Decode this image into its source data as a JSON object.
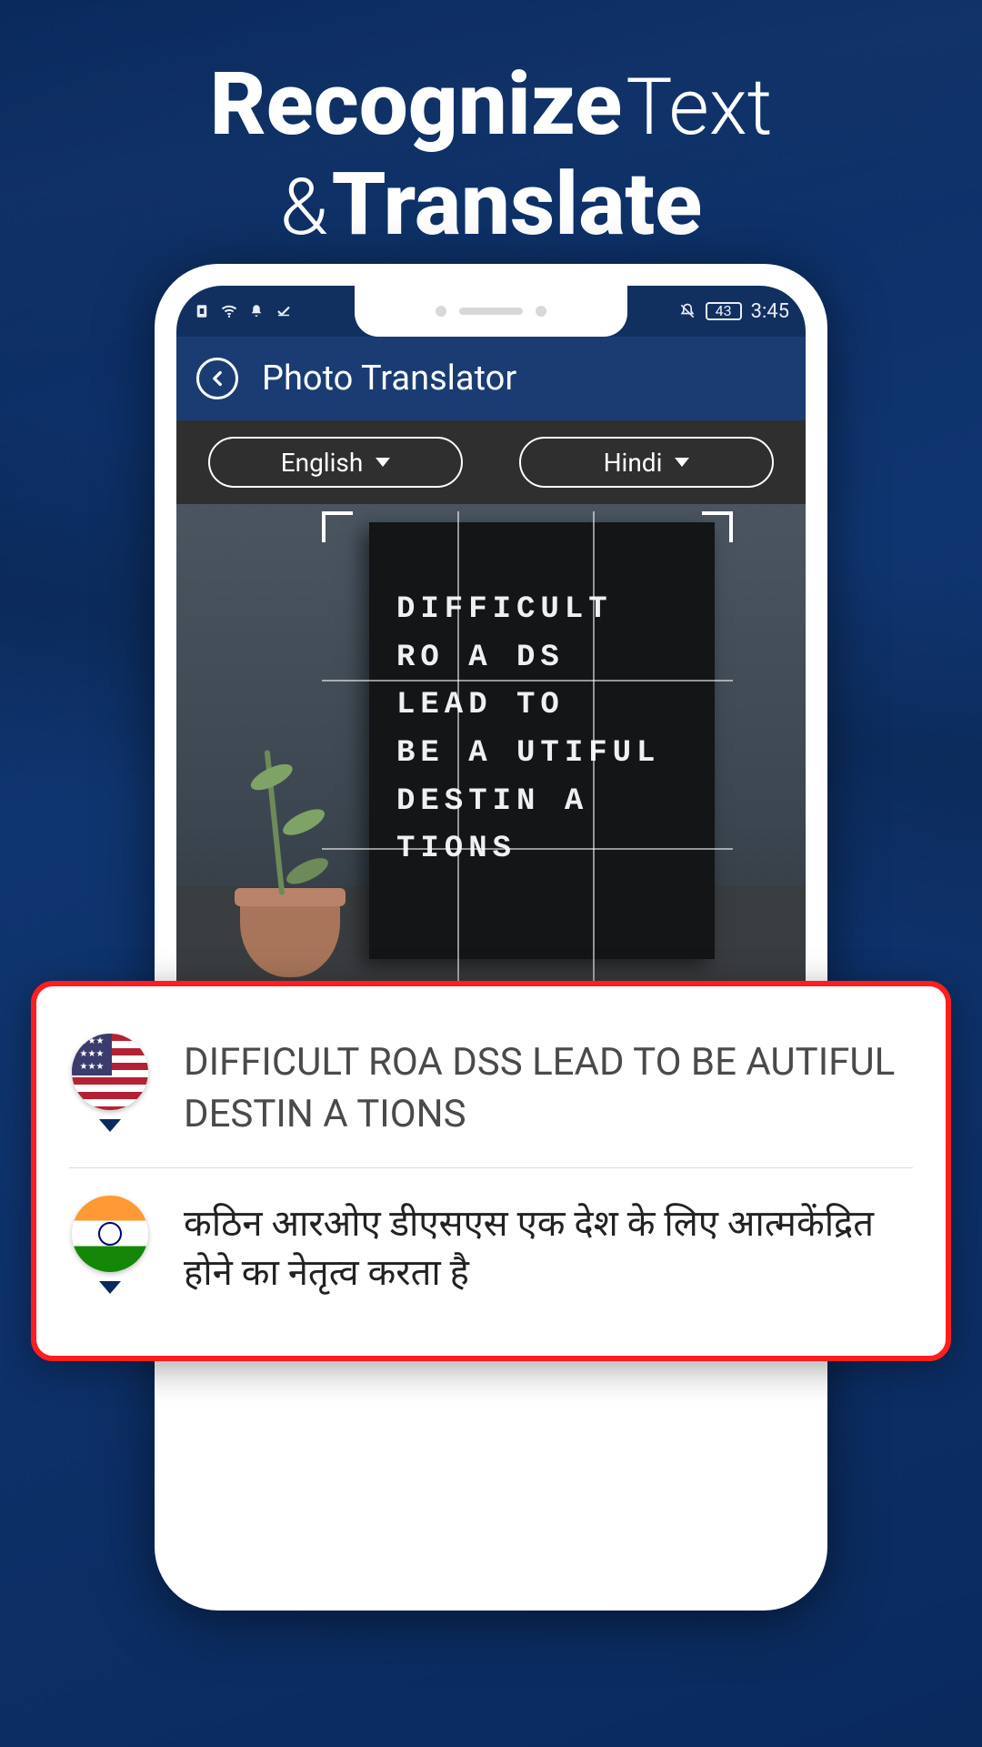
{
  "promo": {
    "line1_bold": "Recognize",
    "line1_light": "Text",
    "line2_light": "&",
    "line2_bold": "Translate"
  },
  "statusbar": {
    "battery": "43",
    "time": "3:45"
  },
  "app": {
    "title": "Photo Translator"
  },
  "languages": {
    "source": "English",
    "target": "Hindi"
  },
  "letterboard": {
    "text": "DIFFICULT\nRO A DS\nLEAD  TO\nBE A UTIFUL\nDESTIN A TIONS"
  },
  "result": {
    "source_text": "DIFFICULT ROA DSS LEAD TO BE AUTIFUL DESTIN A TIONS",
    "target_text": "कठिन आरओए डीएसएस एक देश के लिए आत्मकेंद्रित होने का नेतृत्व करता है"
  }
}
